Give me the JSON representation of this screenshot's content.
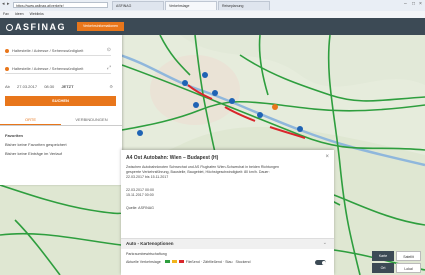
{
  "browser": {
    "tabs": [
      "ASFINAG",
      "Verkehrslage",
      "Reiseplanung"
    ],
    "address": "https://www.asfinag.at/verkehr/",
    "favorites": [
      "Fav",
      "Ideen",
      "Weblinks"
    ]
  },
  "header": {
    "logo": "ASFINAG",
    "button": "Verkehrsinformationen"
  },
  "sidebar": {
    "from_placeholder": "Haltestelle / Adresse / Sehenswürdigkeit",
    "to_placeholder": "Haltestelle / Adresse / Sehenswürdigkeit",
    "date_label": "Ab",
    "date": "27.03.2017",
    "time": "08:30",
    "now_label": "JETZT",
    "search": "SUCHEN",
    "tabs": [
      "ORTE",
      "VERBINDUNGEN"
    ],
    "list_heading": "Favoriten",
    "list_items": [
      "Bisher keine Favoriten gespeichert",
      "Bisher keine Einträge im Verlauf"
    ]
  },
  "panel": {
    "title": "A4 Ost Autobahn: Wien – Budapest (H)",
    "body_lines": [
      "Zwischen Autobahnknoten Schwechat und AS Flughafen Wien-Schwechat in beiden Richtungen",
      "gesperrte Verkehrsführung, Baustelle, Baugebiet, Höchstgeschwindigkeit: 80 km/h. Dauer:",
      "22.03.2017 bis 15.11.2017"
    ],
    "date_lines": [
      "22.03.2017 00:00",
      "15.11.2017 00:00"
    ],
    "source": "Quelle: ASFINAG",
    "section_title": "Auto - Kartenoptionen",
    "option_1": "Parkraumbewirtschaftung",
    "option_2": "Aktuelle Verkehrslage",
    "option_2_legend": "Fließend · Zähfließend · Stau",
    "option_2_tail": "Stockend"
  },
  "controls": {
    "top_left": "Karte",
    "top_right": "Satellit",
    "bottom_left": "Ort",
    "bottom_right": "Lokal"
  },
  "colors": {
    "accent": "#e8761b",
    "header": "#3c4a55",
    "traffic_flow": "#2e9e3e",
    "traffic_jam": "#d9262b"
  }
}
